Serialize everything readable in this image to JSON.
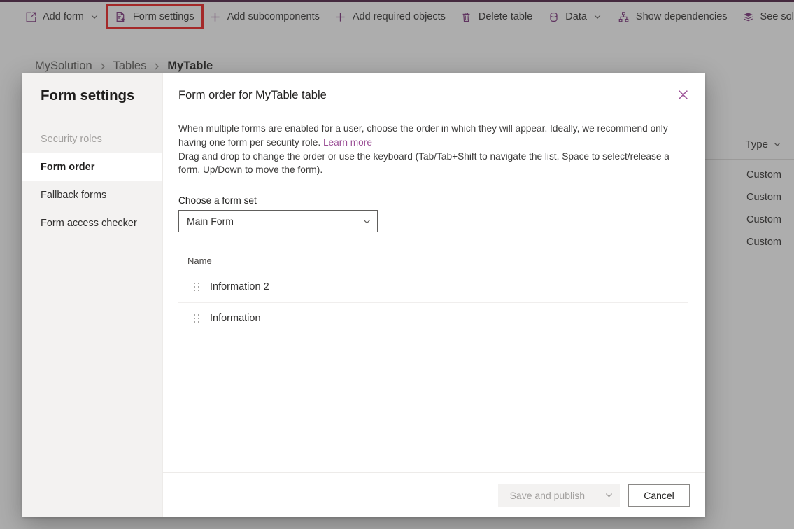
{
  "theme": {
    "accent_bar": "#4b1c40",
    "icon_purple": "#7b2f7b",
    "link_purple": "#9b4f96",
    "highlight_red": "#f01c1c",
    "sidebar_bg": "#f3f2f1"
  },
  "command_bar": {
    "items": [
      {
        "icon": "add-form-icon",
        "label": "Add form",
        "chevron": true
      },
      {
        "icon": "form-settings-icon",
        "label": "Form settings",
        "chevron": false,
        "highlighted": true
      },
      {
        "icon": "plus-icon",
        "label": "Add subcomponents",
        "chevron": false
      },
      {
        "icon": "plus-icon",
        "label": "Add required objects",
        "chevron": false
      },
      {
        "icon": "trash-icon",
        "label": "Delete table",
        "chevron": false
      },
      {
        "icon": "database-icon",
        "label": "Data",
        "chevron": true
      },
      {
        "icon": "dependencies-icon",
        "label": "Show dependencies",
        "chevron": false
      },
      {
        "icon": "layers-icon",
        "label": "See solution layers",
        "chevron": false
      }
    ]
  },
  "breadcrumb": {
    "items": [
      "MySolution",
      "Tables"
    ],
    "current": "MyTable",
    "separator": "›"
  },
  "background_grid": {
    "column_header": "Type",
    "rows": [
      "Custom",
      "Custom",
      "Custom",
      "Custom"
    ]
  },
  "dialog": {
    "sidebar": {
      "title": "Form settings",
      "items": [
        {
          "label": "Security roles",
          "state": "disabled"
        },
        {
          "label": "Form order",
          "state": "selected"
        },
        {
          "label": "Fallback forms",
          "state": "normal"
        },
        {
          "label": "Form access checker",
          "state": "normal"
        }
      ]
    },
    "title": "Form order for MyTable table",
    "close_label": "Close",
    "description": {
      "paragraph1_before_link": "When multiple forms are enabled for a user, choose the order in which they will appear. Ideally, we recommend only having one form per security role. ",
      "link_text": "Learn more",
      "paragraph2": "Drag and drop to change the order or use the keyboard (Tab/Tab+Shift to navigate the list, Space to select/release a form, Up/Down to move the form)."
    },
    "form_set": {
      "label": "Choose a form set",
      "selected": "Main Form",
      "options": [
        "Main Form"
      ]
    },
    "list": {
      "column_header": "Name",
      "rows": [
        {
          "name": "Information 2"
        },
        {
          "name": "Information"
        }
      ]
    },
    "footer": {
      "primary_label": "Save and publish",
      "primary_disabled": true,
      "cancel_label": "Cancel"
    }
  }
}
